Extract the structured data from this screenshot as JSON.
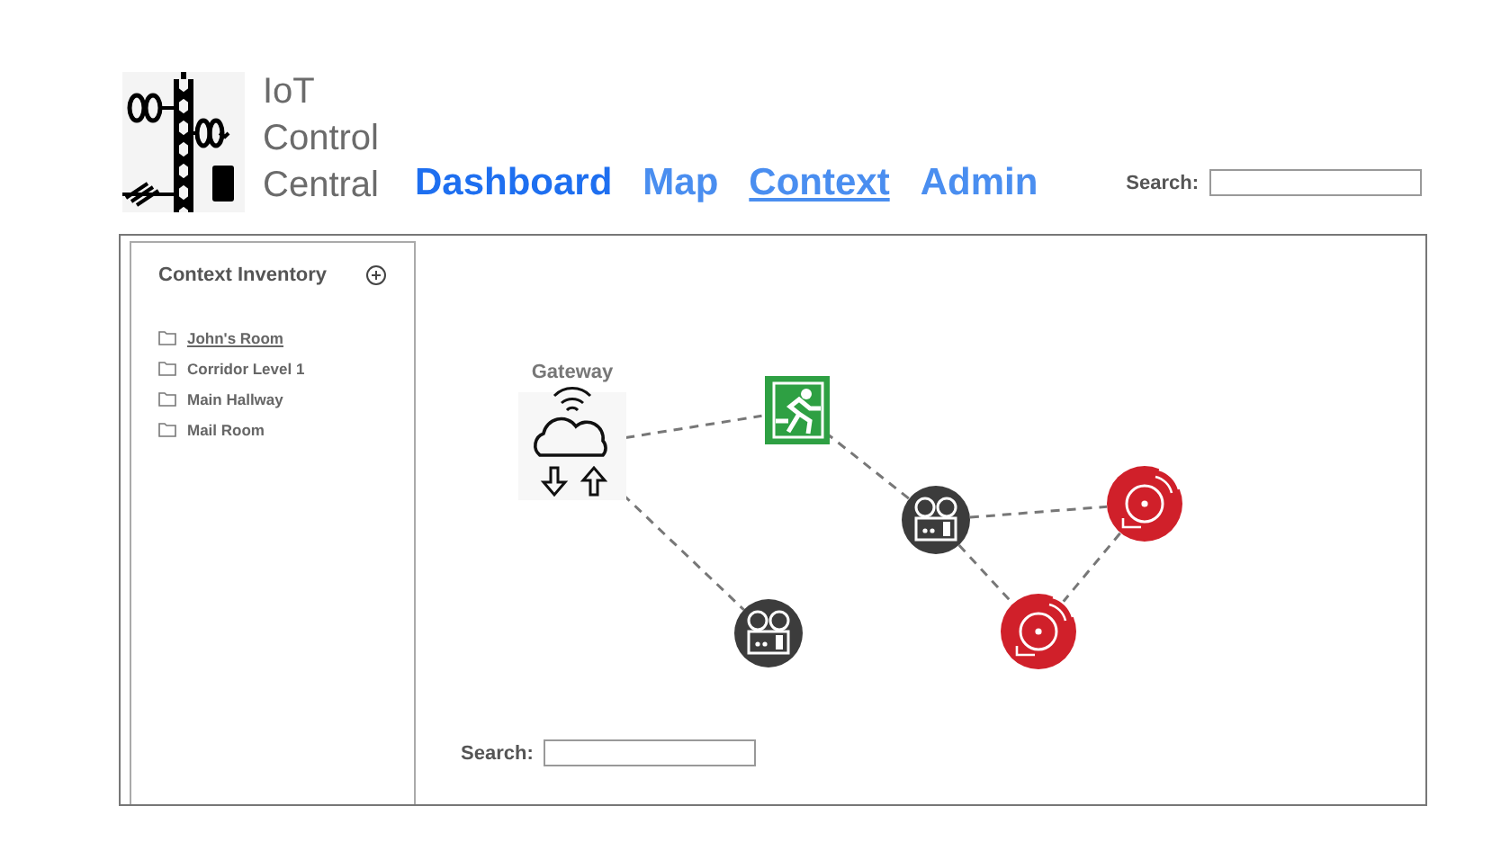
{
  "app": {
    "title_lines": [
      "IoT",
      "Control",
      "Central"
    ]
  },
  "nav": [
    {
      "label": "Dashboard",
      "selected": false
    },
    {
      "label": "Map",
      "selected": false
    },
    {
      "label": "Context",
      "selected": true
    },
    {
      "label": "Admin",
      "selected": false
    }
  ],
  "header_search": {
    "label": "Search:"
  },
  "sidebar": {
    "title": "Context Inventory",
    "items": [
      {
        "label": "John's Room",
        "selected": true
      },
      {
        "label": "Corridor Level 1",
        "selected": false
      },
      {
        "label": "Main Hallway",
        "selected": false
      },
      {
        "label": "Mail Room",
        "selected": false
      }
    ]
  },
  "diagram": {
    "nodes": [
      {
        "kind": "gateway",
        "label": "Gateway"
      },
      {
        "kind": "exit"
      },
      {
        "kind": "camera"
      },
      {
        "kind": "camera"
      },
      {
        "kind": "alarm"
      },
      {
        "kind": "alarm"
      }
    ]
  },
  "canvas_search": {
    "label": "Search:"
  }
}
